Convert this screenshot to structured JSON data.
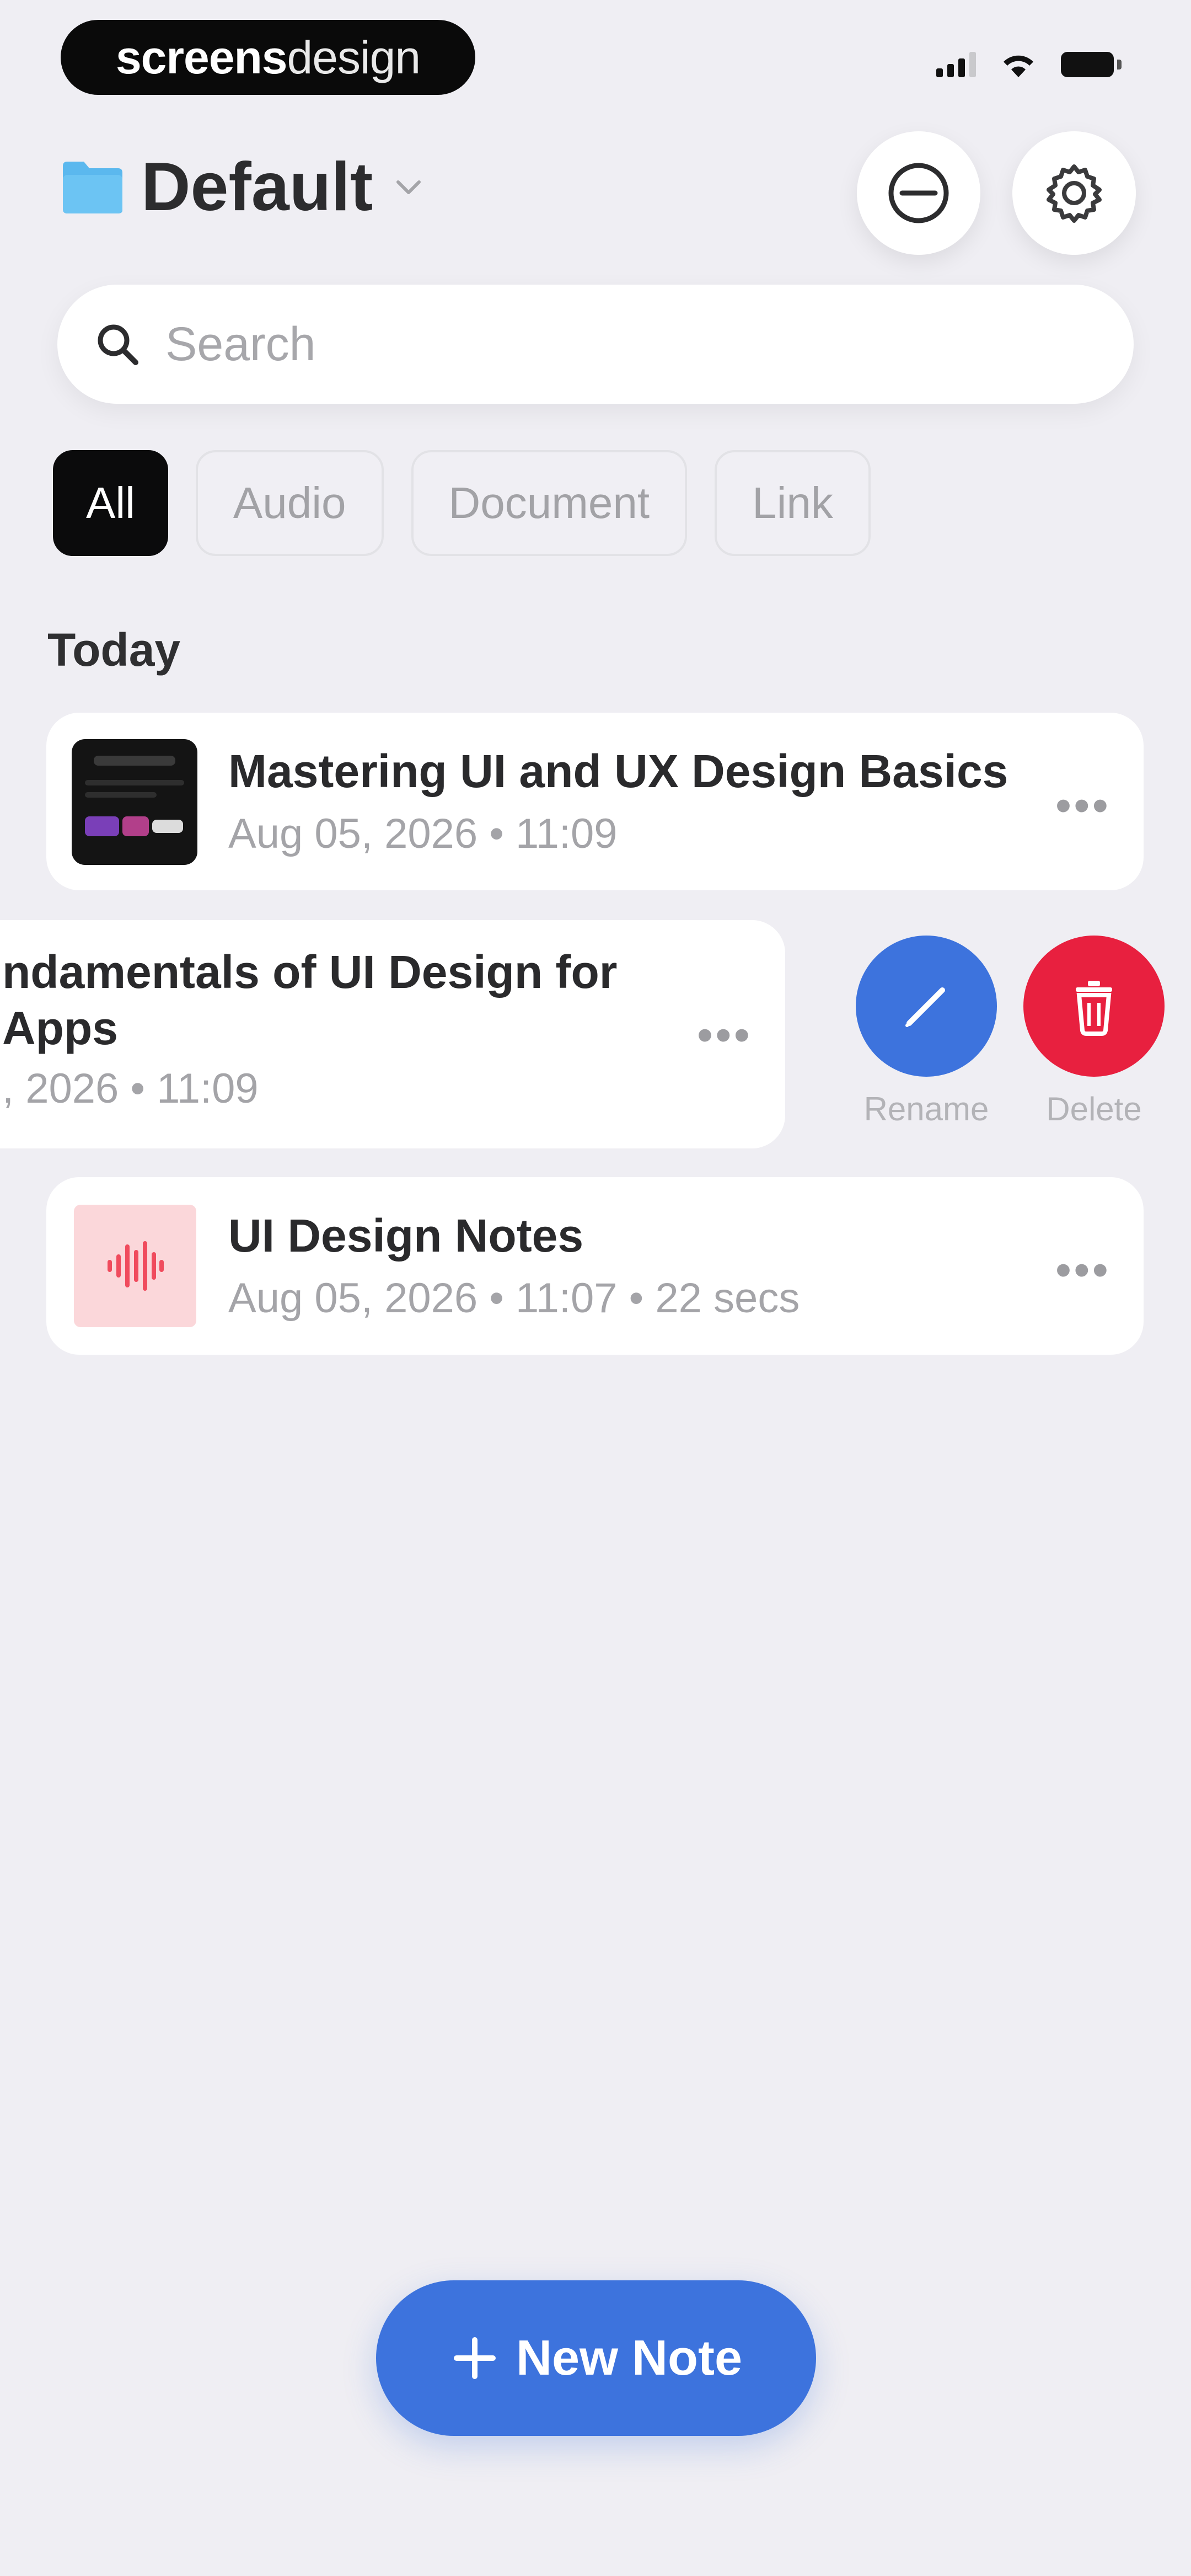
{
  "status_bar": {
    "brand_part1": "screens",
    "brand_part2": "design"
  },
  "header": {
    "folder_name": "Default"
  },
  "search": {
    "placeholder": "Search"
  },
  "filters": [
    "All",
    "Audio",
    "Document",
    "Link"
  ],
  "active_filter": "All",
  "section": {
    "label": "Today"
  },
  "notes": [
    {
      "title": "Mastering UI and UX Design Basics",
      "meta": "Aug 05, 2026 • 11:09",
      "thumbnail": "document-preview"
    },
    {
      "title_line1": "ndamentals of UI Design for",
      "title_line2": "Apps",
      "meta": ", 2026 • 11:09",
      "swiped": true
    },
    {
      "title": "UI Design Notes",
      "meta": "Aug 05, 2026 • 11:07 • 22 secs",
      "thumbnail": "audio-waveform-icon"
    }
  ],
  "swipe_actions": {
    "rename_label": "Rename",
    "delete_label": "Delete",
    "rename_color": "#3d73dd",
    "delete_color": "#e8203f"
  },
  "fab": {
    "label": "New Note",
    "color": "#3d73dd"
  },
  "colors": {
    "background": "#efeef3",
    "folder": "#5bb8ee"
  }
}
